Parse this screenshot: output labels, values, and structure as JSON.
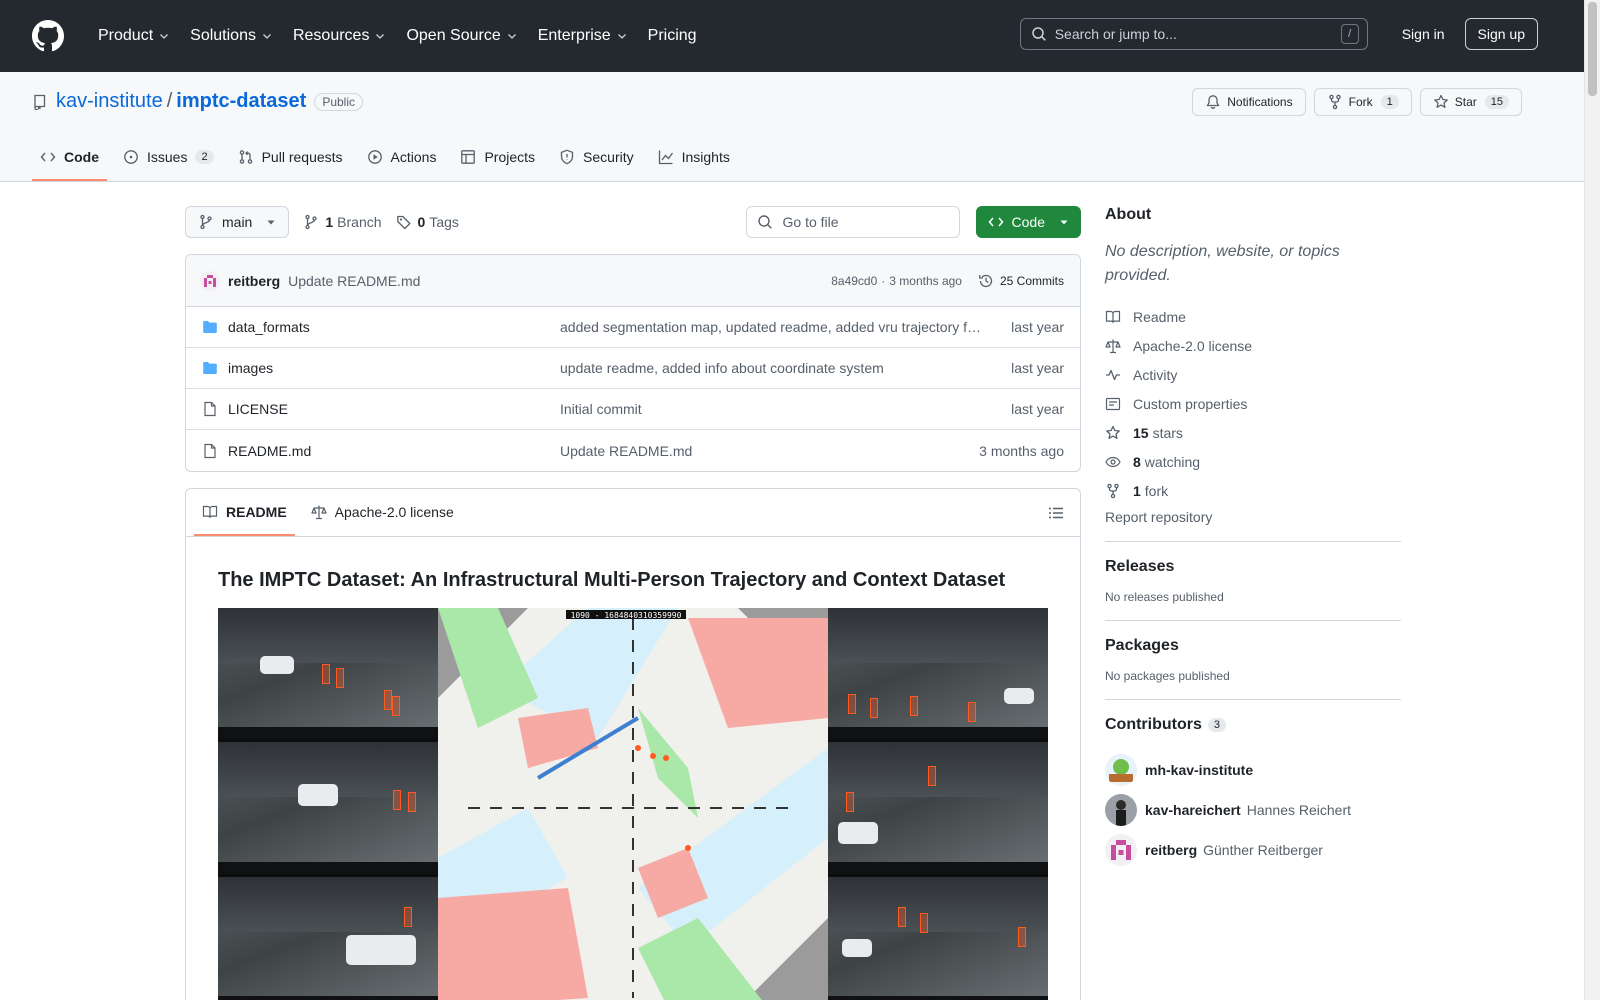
{
  "header": {
    "nav": [
      "Product",
      "Solutions",
      "Resources",
      "Open Source",
      "Enterprise",
      "Pricing"
    ],
    "search_placeholder": "Search or jump to...",
    "search_key": "/",
    "sign_in": "Sign in",
    "sign_up": "Sign up"
  },
  "repo": {
    "owner": "kav-institute",
    "separator": "/",
    "name": "imptc-dataset",
    "visibility": "Public",
    "notifications_label": "Notifications",
    "fork_label": "Fork",
    "fork_count": "1",
    "star_label": "Star",
    "star_count": "15"
  },
  "tabs": [
    {
      "label": "Code",
      "icon": "code-icon",
      "active": true
    },
    {
      "label": "Issues",
      "icon": "issue-icon",
      "count": "2"
    },
    {
      "label": "Pull requests",
      "icon": "pull-request-icon"
    },
    {
      "label": "Actions",
      "icon": "play-icon"
    },
    {
      "label": "Projects",
      "icon": "table-icon"
    },
    {
      "label": "Security",
      "icon": "shield-icon"
    },
    {
      "label": "Insights",
      "icon": "graph-icon"
    }
  ],
  "toolbar": {
    "branch": "main",
    "branch_count": "1",
    "branch_label": "Branch",
    "tag_count": "0",
    "tag_label": "Tags",
    "go_to_file": "Go to file",
    "code_button": "Code"
  },
  "latest_commit": {
    "author": "reitberg",
    "message": "Update README.md",
    "hash": "8a49cd0",
    "dot": "·",
    "age": "3 months ago",
    "commits": "25 Commits"
  },
  "files": [
    {
      "type": "folder",
      "name": "data_formats",
      "commit": "added segmentation map, updated readme, added vru trajectory formats",
      "age": "last year"
    },
    {
      "type": "folder",
      "name": "images",
      "commit": "update readme, added info about coordinate system",
      "age": "last year"
    },
    {
      "type": "file",
      "name": "LICENSE",
      "commit": "Initial commit",
      "age": "last year"
    },
    {
      "type": "file",
      "name": "README.md",
      "commit": "Update README.md",
      "age": "3 months ago"
    }
  ],
  "readme": {
    "tab_readme": "README",
    "tab_license": "Apache-2.0 license",
    "heading": "The IMPTC Dataset: An Infrastructural Multi-Person Trajectory and Context Dataset",
    "frame_label": "1090 - 1684840310359990"
  },
  "about": {
    "title": "About",
    "description": "No description, website, or topics provided.",
    "items": [
      {
        "icon": "book-icon",
        "label": "Readme"
      },
      {
        "icon": "law-icon",
        "label": "Apache-2.0 license"
      },
      {
        "icon": "pulse-icon",
        "label": "Activity"
      },
      {
        "icon": "note-icon",
        "label": "Custom properties"
      },
      {
        "icon": "star-icon",
        "count": "15",
        "label": "stars"
      },
      {
        "icon": "eye-icon",
        "count": "8",
        "label": "watching"
      },
      {
        "icon": "fork-icon",
        "count": "1",
        "label": "fork"
      }
    ],
    "report": "Report repository"
  },
  "releases": {
    "title": "Releases",
    "empty": "No releases published"
  },
  "packages": {
    "title": "Packages",
    "empty": "No packages published"
  },
  "contributors": {
    "title": "Contributors",
    "count": "3",
    "list": [
      {
        "login": "mh-kav-institute",
        "name": ""
      },
      {
        "login": "kav-hareichert",
        "name": "Hannes Reichert"
      },
      {
        "login": "reitberg",
        "name": "Günther Reitberger"
      }
    ]
  },
  "colors": {
    "accent": "#0969da",
    "green": "#1f883d",
    "header": "#24292f",
    "tab_underline": "#fd8c73"
  }
}
